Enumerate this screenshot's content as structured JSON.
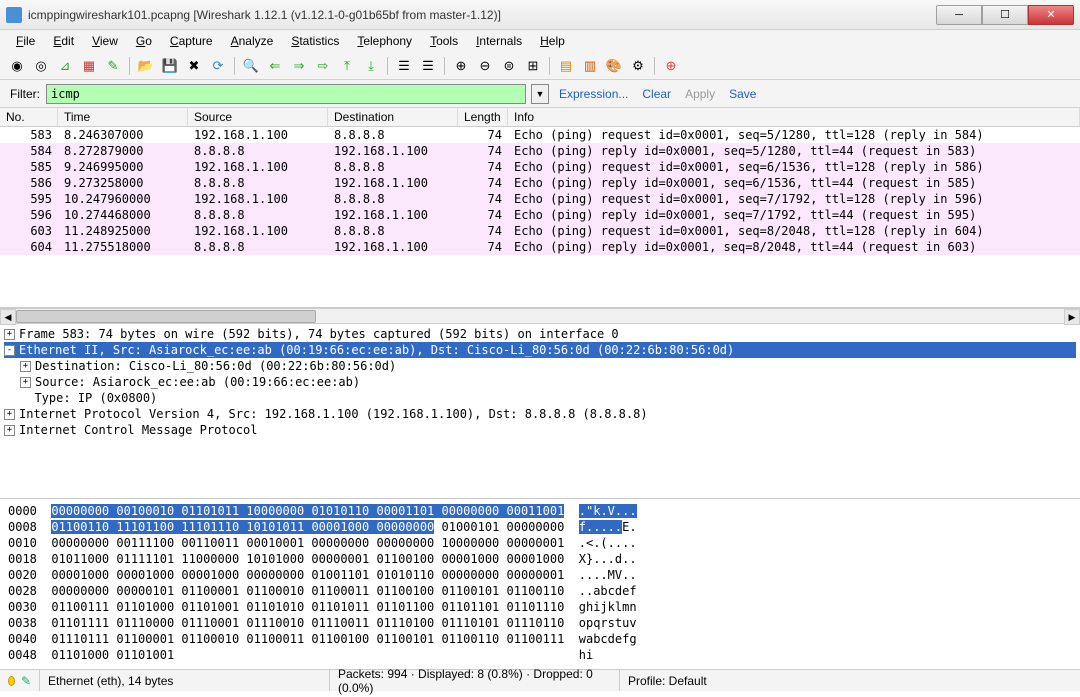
{
  "title": "icmppingwireshark101.pcapng   [Wireshark 1.12.1 (v1.12.1-0-g01b65bf from master-1.12)]",
  "menu": [
    "File",
    "Edit",
    "View",
    "Go",
    "Capture",
    "Analyze",
    "Statistics",
    "Telephony",
    "Tools",
    "Internals",
    "Help"
  ],
  "filter": {
    "label": "Filter:",
    "value": "icmp",
    "expression": "Expression...",
    "clear": "Clear",
    "apply": "Apply",
    "save": "Save"
  },
  "columns": {
    "no": "No.",
    "time": "Time",
    "src": "Source",
    "dst": "Destination",
    "len": "Length",
    "info": "Info"
  },
  "packets": [
    {
      "no": "583",
      "time": "8.246307000",
      "src": "192.168.1.100",
      "dst": "8.8.8.8",
      "len": "74",
      "info": "Echo (ping) request  id=0x0001, seq=5/1280, ttl=128 (reply in 584)",
      "pink": false
    },
    {
      "no": "584",
      "time": "8.272879000",
      "src": "8.8.8.8",
      "dst": "192.168.1.100",
      "len": "74",
      "info": "Echo (ping) reply    id=0x0001, seq=5/1280, ttl=44 (request in 583)",
      "pink": true
    },
    {
      "no": "585",
      "time": "9.246995000",
      "src": "192.168.1.100",
      "dst": "8.8.8.8",
      "len": "74",
      "info": "Echo (ping) request  id=0x0001, seq=6/1536, ttl=128 (reply in 586)",
      "pink": true
    },
    {
      "no": "586",
      "time": "9.273258000",
      "src": "8.8.8.8",
      "dst": "192.168.1.100",
      "len": "74",
      "info": "Echo (ping) reply    id=0x0001, seq=6/1536, ttl=44 (request in 585)",
      "pink": true
    },
    {
      "no": "595",
      "time": "10.247960000",
      "src": "192.168.1.100",
      "dst": "8.8.8.8",
      "len": "74",
      "info": "Echo (ping) request  id=0x0001, seq=7/1792, ttl=128 (reply in 596)",
      "pink": true
    },
    {
      "no": "596",
      "time": "10.274468000",
      "src": "8.8.8.8",
      "dst": "192.168.1.100",
      "len": "74",
      "info": "Echo (ping) reply    id=0x0001, seq=7/1792, ttl=44 (request in 595)",
      "pink": true
    },
    {
      "no": "603",
      "time": "11.248925000",
      "src": "192.168.1.100",
      "dst": "8.8.8.8",
      "len": "74",
      "info": "Echo (ping) request  id=0x0001, seq=8/2048, ttl=128 (reply in 604)",
      "pink": true
    },
    {
      "no": "604",
      "time": "11.275518000",
      "src": "8.8.8.8",
      "dst": "192.168.1.100",
      "len": "74",
      "info": "Echo (ping) reply    id=0x0001, seq=8/2048, ttl=44 (request in 603)",
      "pink": true
    }
  ],
  "tree": [
    {
      "indent": 0,
      "exp": "+",
      "sel": false,
      "text": "Frame 583: 74 bytes on wire (592 bits), 74 bytes captured (592 bits) on interface 0"
    },
    {
      "indent": 0,
      "exp": "-",
      "sel": true,
      "text": "Ethernet II, Src: Asiarock_ec:ee:ab (00:19:66:ec:ee:ab), Dst: Cisco-Li_80:56:0d (00:22:6b:80:56:0d)"
    },
    {
      "indent": 1,
      "exp": "+",
      "sel": false,
      "text": "Destination: Cisco-Li_80:56:0d (00:22:6b:80:56:0d)"
    },
    {
      "indent": 1,
      "exp": "+",
      "sel": false,
      "text": "Source: Asiarock_ec:ee:ab (00:19:66:ec:ee:ab)"
    },
    {
      "indent": 1,
      "exp": "",
      "sel": false,
      "text": "  Type: IP (0x0800)"
    },
    {
      "indent": 0,
      "exp": "+",
      "sel": false,
      "text": "Internet Protocol Version 4, Src: 192.168.1.100 (192.168.1.100), Dst: 8.8.8.8 (8.8.8.8)"
    },
    {
      "indent": 0,
      "exp": "+",
      "sel": false,
      "text": "Internet Control Message Protocol"
    }
  ],
  "hex": [
    {
      "off": "0000",
      "b1": "00000000 00100010 01101011 10000000 01010110 00001101 00000000 00011001",
      "sel1": true,
      "a": ".\"k.V...",
      "asel": 8
    },
    {
      "off": "0008",
      "b1": "01100110 11101100 11101110 10101011 00001000 00000000",
      "sel1": true,
      "b2": " 01000101 00000000",
      "a": "f.....E.",
      "asel": 6
    },
    {
      "off": "0010",
      "b1": "00000000 00111100 00110011 00010001 00000000 00000000 10000000 00000001",
      "sel1": false,
      "a": ".<.(....",
      "asel": 0
    },
    {
      "off": "0018",
      "b1": "01011000 01111101 11000000 10101000 00000001 01100100 00001000 00001000",
      "sel1": false,
      "a": "X}...d..",
      "asel": 0
    },
    {
      "off": "0020",
      "b1": "00001000 00001000 00001000 00000000 01001101 01010110 00000000 00000001",
      "sel1": false,
      "a": "....MV..",
      "asel": 0
    },
    {
      "off": "0028",
      "b1": "00000000 00000101 01100001 01100010 01100011 01100100 01100101 01100110",
      "sel1": false,
      "a": "..abcdef",
      "asel": 0
    },
    {
      "off": "0030",
      "b1": "01100111 01101000 01101001 01101010 01101011 01101100 01101101 01101110",
      "sel1": false,
      "a": "ghijklmn",
      "asel": 0
    },
    {
      "off": "0038",
      "b1": "01101111 01110000 01110001 01110010 01110011 01110100 01110101 01110110",
      "sel1": false,
      "a": "opqrstuv",
      "asel": 0
    },
    {
      "off": "0040",
      "b1": "01110111 01100001 01100010 01100011 01100100 01100101 01100110 01100111",
      "sel1": false,
      "a": "wabcdefg",
      "asel": 0
    },
    {
      "off": "0048",
      "b1": "01101000 01101001",
      "sel1": false,
      "a": "hi",
      "asel": 0
    }
  ],
  "status": {
    "left": "Ethernet (eth), 14 bytes",
    "center": "Packets: 994 · Displayed: 8 (0.8%) · Dropped: 0 (0.0%)",
    "right": "Profile: Default"
  },
  "toolbar_icons": [
    "record-icon",
    "stop-icon",
    "restart-icon",
    "options-icon",
    "open-icon",
    "save-icon",
    "close-file-icon",
    "reload-icon",
    "find-icon",
    "back-icon",
    "forward-icon",
    "jump-icon",
    "first-icon",
    "last-icon",
    "colorize-icon",
    "auto-scroll-icon",
    "zoom-in-icon",
    "zoom-out-icon",
    "zoom-reset-icon",
    "resize-cols-icon",
    "capture-filter-icon",
    "display-filter-icon",
    "coloring-icon",
    "prefs-icon",
    "help-icon"
  ]
}
